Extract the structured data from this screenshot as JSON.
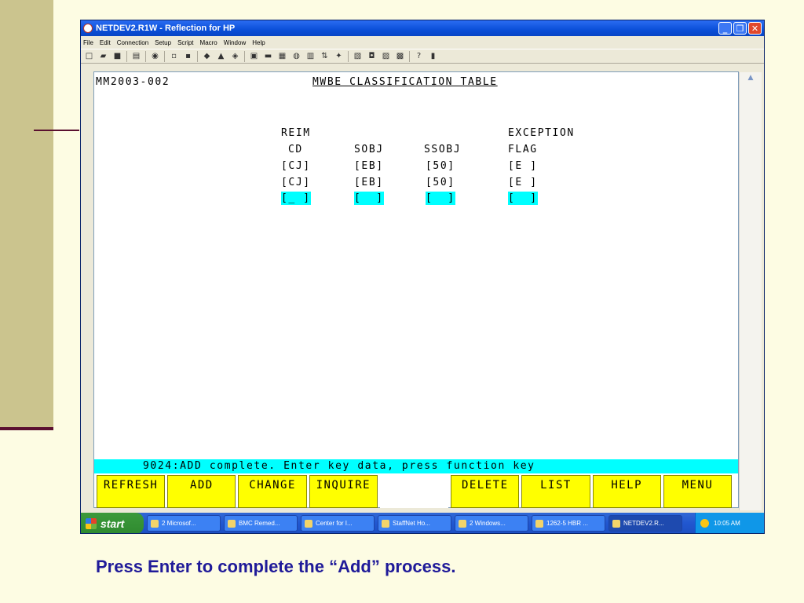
{
  "window": {
    "title": "NETDEV2.R1W - Reflection for HP",
    "min_glyph": "_",
    "max_glyph": "❐",
    "close_glyph": "✕"
  },
  "menu": [
    "File",
    "Edit",
    "Connection",
    "Setup",
    "Script",
    "Macro",
    "Window",
    "Help"
  ],
  "screen": {
    "id": "MM2003-002",
    "title": "MWBE CLASSIFICATION TABLE",
    "headers": {
      "reim_line1": "REIM",
      "reim_line2": "CD",
      "sobj": "SOBJ",
      "ssobj": "SSOBJ",
      "exc_line1": "EXCEPTION",
      "exc_line2": "FLAG"
    },
    "rows": [
      [
        "[CJ]",
        "[EB]",
        "[50]",
        "[E ]"
      ],
      [
        "[CJ]",
        "[EB]",
        "[50]",
        "[E ]"
      ]
    ],
    "input_row": [
      "[_ ]",
      "[  ]",
      "[  ]",
      "[  ]"
    ],
    "status_message": "9024:ADD complete. Enter key data, press function key"
  },
  "function_keys": [
    "REFRESH",
    "ADD",
    "CHANGE",
    "INQUIRE",
    "",
    "DELETE",
    "LIST",
    "HELP",
    "MENU"
  ],
  "taskbar": {
    "start_label": "start",
    "tasks": [
      "2 Microsof...",
      "BMC Remed...",
      "Center for I...",
      "StaffNet Ho...",
      "2 Windows...",
      "1262-5 HBR ...",
      "NETDEV2.R..."
    ],
    "clock": "10:05 AM"
  },
  "caption": "Press Enter to complete the “Add” process."
}
